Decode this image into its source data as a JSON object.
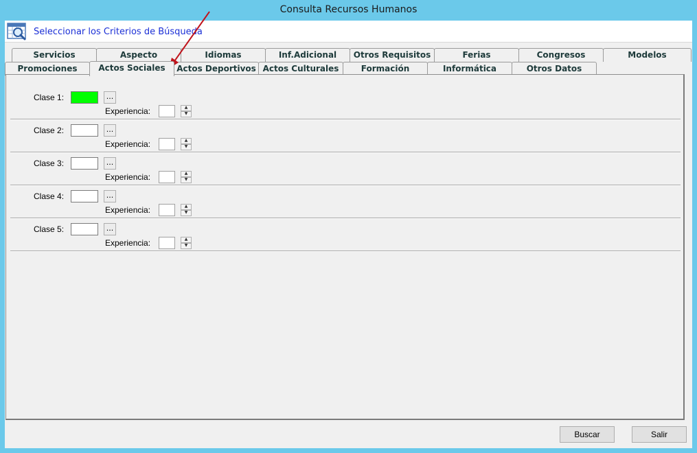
{
  "window": {
    "title": "Consulta Recursos Humanos"
  },
  "header": {
    "title": "Seleccionar los Criterios de Búsqueda",
    "icon": "search-calendar-icon"
  },
  "tabs_back": [
    {
      "label": "Servicios"
    },
    {
      "label": "Aspecto"
    },
    {
      "label": "Idiomas"
    },
    {
      "label": "Inf.Adicional"
    },
    {
      "label": "Otros Requisitos"
    },
    {
      "label": "Ferias"
    },
    {
      "label": "Congresos"
    },
    {
      "label": "Modelos"
    }
  ],
  "tabs_front": [
    {
      "label": "Promociones"
    },
    {
      "label": "Actos Sociales"
    },
    {
      "label": "Actos Deportivos"
    },
    {
      "label": "Actos Culturales"
    },
    {
      "label": "Formación"
    },
    {
      "label": "Informática"
    },
    {
      "label": "Otros Datos"
    }
  ],
  "active_tab": "Actos Sociales",
  "rows": [
    {
      "clase_label": "Clase 1:",
      "clase_value": "",
      "dots": "...",
      "exp_label": "Experiencia:",
      "exp_value": "",
      "highlight": "#00ff00"
    },
    {
      "clase_label": "Clase 2:",
      "clase_value": "",
      "dots": "...",
      "exp_label": "Experiencia:",
      "exp_value": ""
    },
    {
      "clase_label": "Clase 3:",
      "clase_value": "",
      "dots": "...",
      "exp_label": "Experiencia:",
      "exp_value": ""
    },
    {
      "clase_label": "Clase 4:",
      "clase_value": "",
      "dots": "...",
      "exp_label": "Experiencia:",
      "exp_value": ""
    },
    {
      "clase_label": "Clase 5:",
      "clase_value": "",
      "dots": "...",
      "exp_label": "Experiencia:",
      "exp_value": ""
    }
  ],
  "buttons": {
    "buscar": "Buscar",
    "salir": "Salir"
  },
  "colors": {
    "titlebar": "#6bc9ea",
    "header_text": "#1b2fd6",
    "arrow": "#c0141c"
  }
}
